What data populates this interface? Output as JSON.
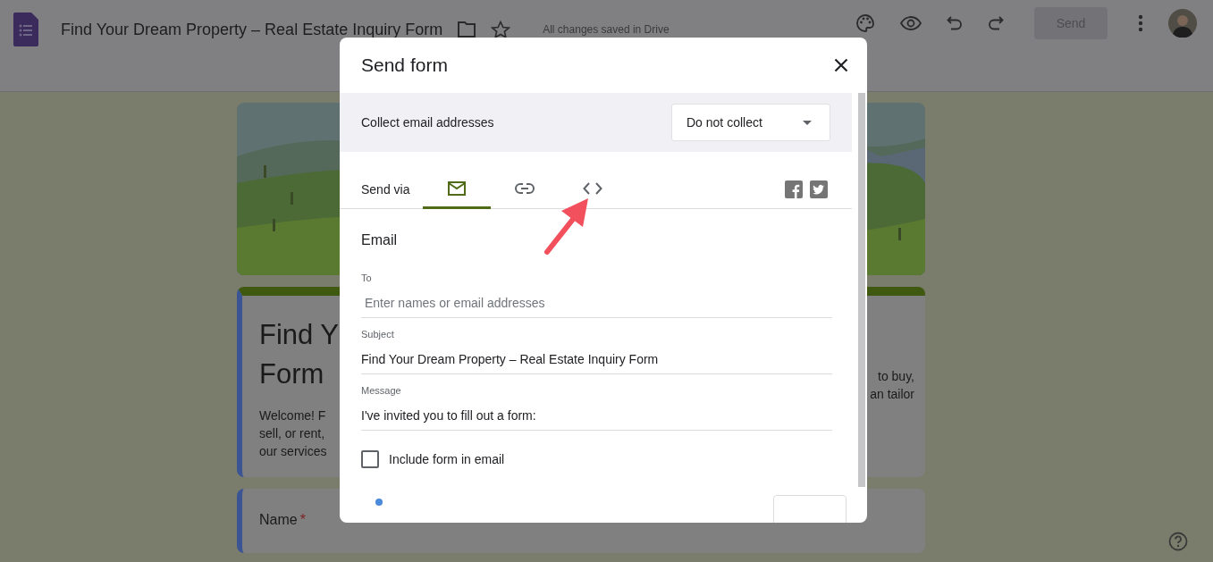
{
  "app": {
    "title": "Find Your Dream Property – Real Estate Inquiry Form",
    "save_status": "All changes saved in Drive",
    "send_button": {
      "label": "Send",
      "disabled": true
    }
  },
  "form_behind": {
    "title_left": [
      "Find Y",
      "Form"
    ],
    "description_left": [
      "Welcome! F",
      "sell, or rent,",
      "our services"
    ],
    "description_right": [
      "to buy,",
      "an tailor"
    ],
    "question": {
      "label": "Name",
      "required_mark": "*"
    }
  },
  "dialog": {
    "title": "Send form",
    "collect": {
      "label": "Collect email addresses",
      "value": "Do not collect"
    },
    "send_via": {
      "label": "Send via",
      "tabs": [
        {
          "kind": "email",
          "selected": true
        },
        {
          "kind": "link",
          "selected": false
        },
        {
          "kind": "embed",
          "selected": false
        }
      ]
    },
    "section": "Email",
    "fields": [
      {
        "label": "To",
        "placeholder": "Enter names or email addresses"
      },
      {
        "label": "Subject",
        "value": "Find Your Dream Property – Real Estate Inquiry Form"
      },
      {
        "label": "Message",
        "value": "I've invited you to fill out a form:"
      }
    ],
    "include": {
      "label": "Include form in email",
      "checked": false
    }
  }
}
